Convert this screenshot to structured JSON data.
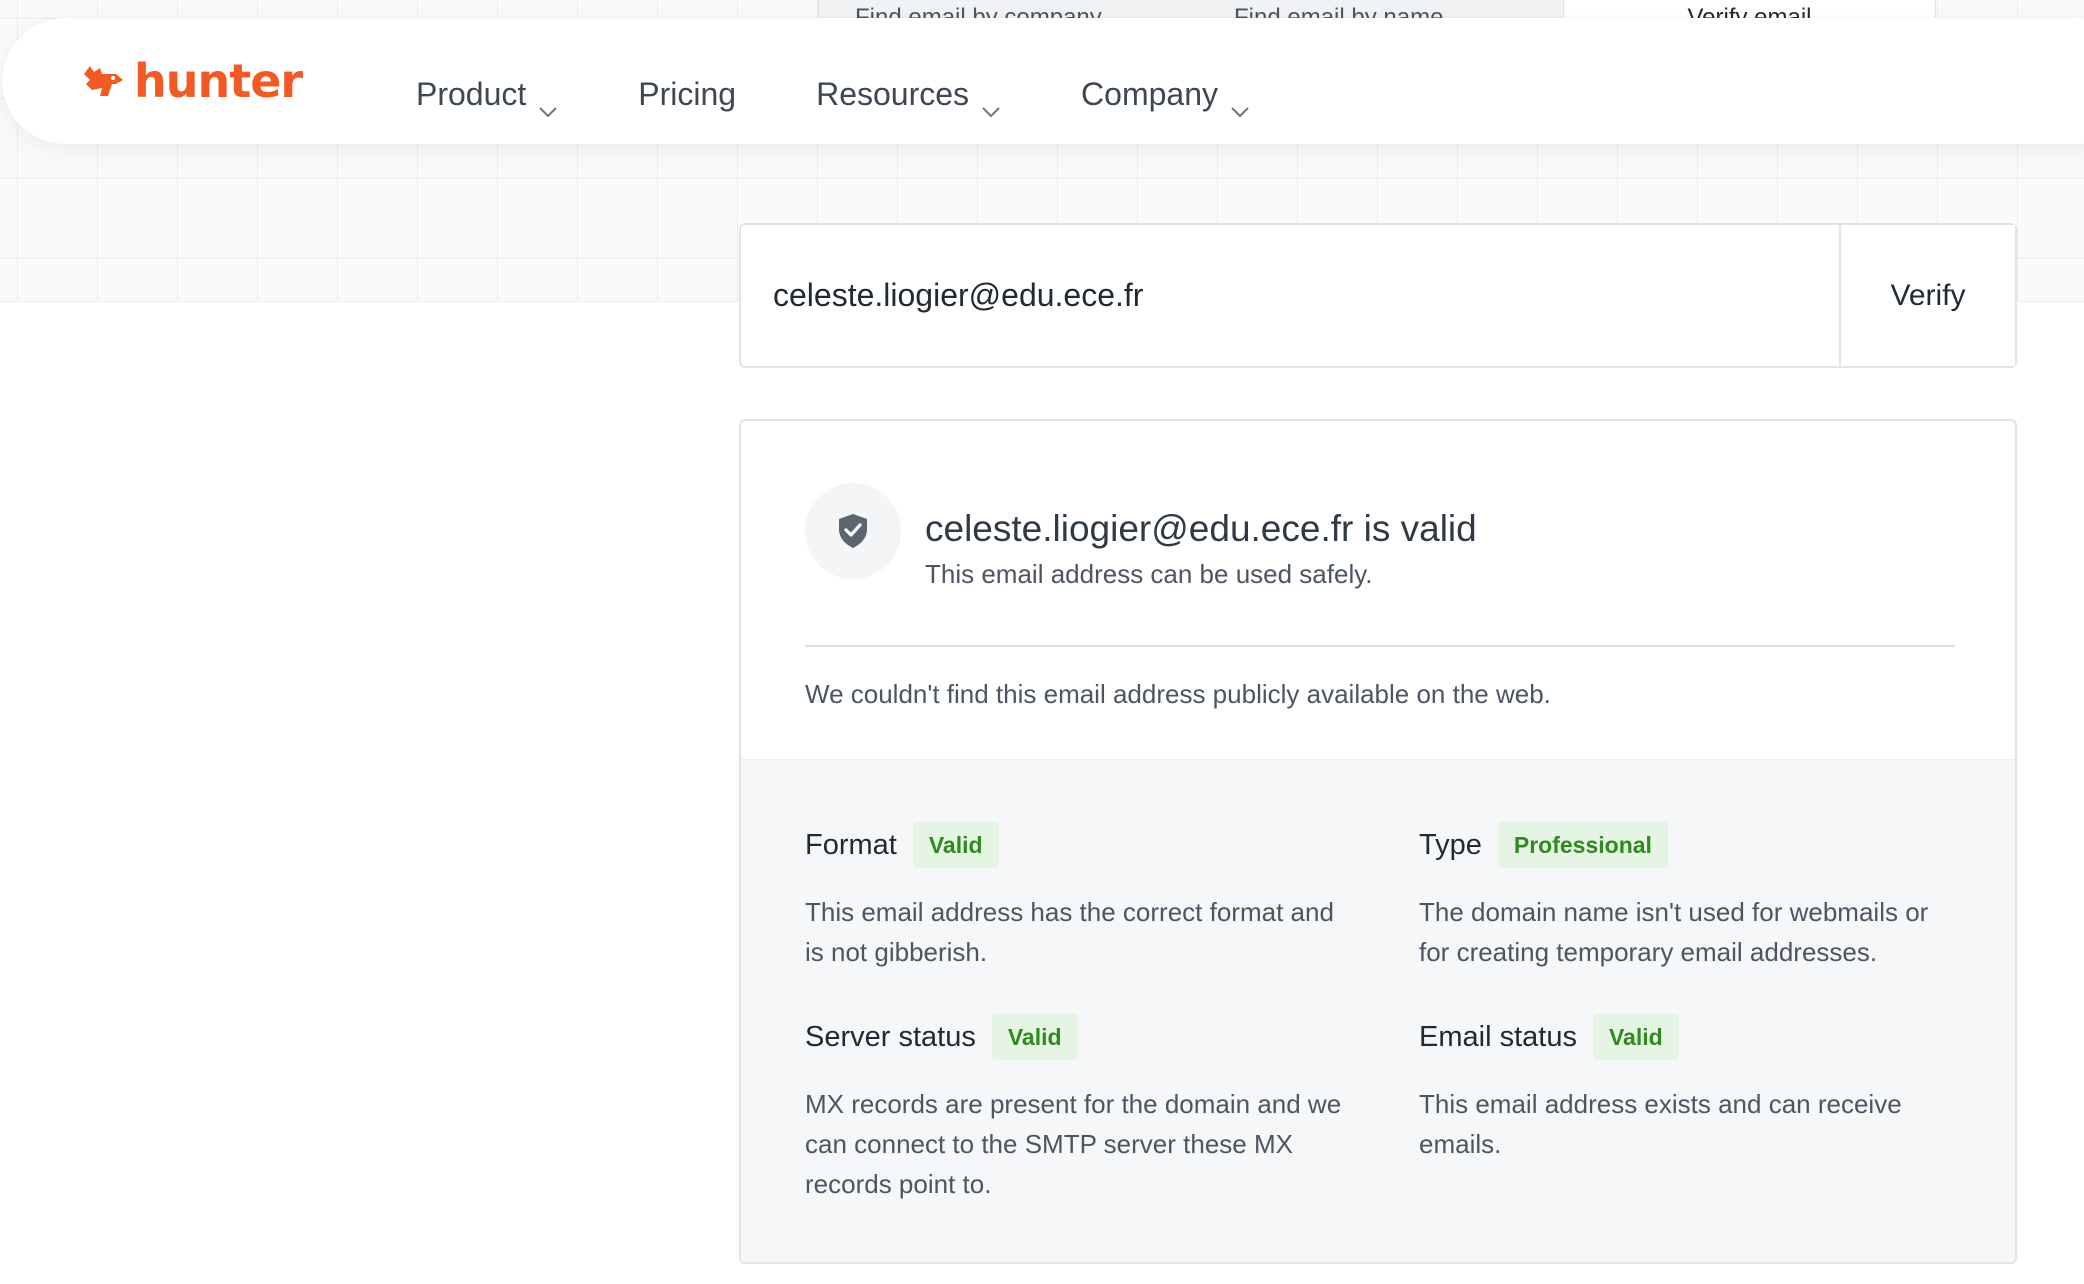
{
  "top_tabs": [
    "Find email by company",
    "Find email by name",
    "Verify email"
  ],
  "brand": {
    "name": "hunter",
    "color": "#f15a24",
    "icon": "fox-head-icon"
  },
  "nav": [
    {
      "label": "Product",
      "has_dropdown": true
    },
    {
      "label": "Pricing",
      "has_dropdown": false
    },
    {
      "label": "Resources",
      "has_dropdown": true
    },
    {
      "label": "Company",
      "has_dropdown": true
    }
  ],
  "verify_form": {
    "email_value": "celeste.liogier@edu.ece.fr",
    "button_label": "Verify"
  },
  "result": {
    "icon": "shield-check-icon",
    "title": "celeste.liogier@edu.ece.fr is valid",
    "subtitle": "This email address can be used safely.",
    "public_note": "We couldn't find this email address publicly available on the web.",
    "details": [
      {
        "label": "Format",
        "badge": "Valid",
        "description": "This email address has the correct format and is not gibberish."
      },
      {
        "label": "Type",
        "badge": "Professional",
        "description": "The domain name isn't used for webmails or for creating temporary email addresses."
      },
      {
        "label": "Server status",
        "badge": "Valid",
        "description": "MX records are present for the domain and we can connect to the SMTP server these MX records point to."
      },
      {
        "label": "Email status",
        "badge": "Valid",
        "description": "This email address exists and can receive emails."
      }
    ]
  },
  "colors": {
    "badge_bg": "#e6f4e3",
    "badge_text": "#2f8a1f",
    "panel_bg": "#f6f7f9"
  }
}
